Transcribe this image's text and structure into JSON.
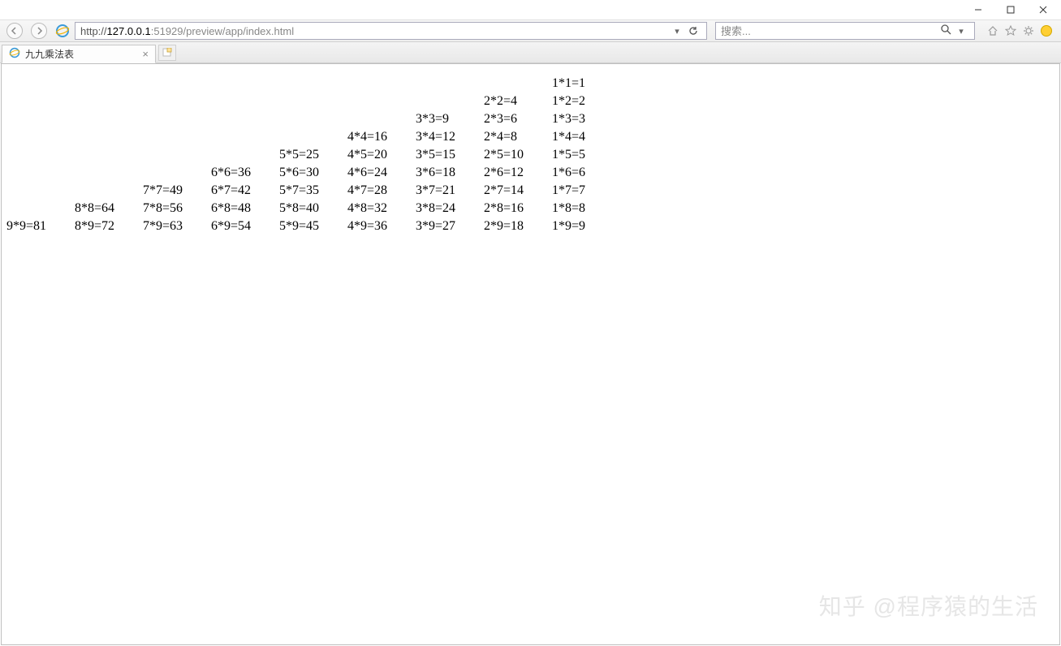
{
  "window": {
    "minimize": "—",
    "maximize": "☐",
    "close": "✕"
  },
  "toolbar": {
    "url_prefix": "http://",
    "url_host": "127.0.0.1",
    "url_rest": ":51929/preview/app/index.html",
    "search_placeholder": "搜索..."
  },
  "tab": {
    "title": "九九乘法表"
  },
  "watermark": "知乎 @程序猿的生活",
  "table": {
    "rows": [
      [
        "",
        "",
        "",
        "",
        "",
        "",
        "",
        "",
        "1*1=1"
      ],
      [
        "",
        "",
        "",
        "",
        "",
        "",
        "",
        "2*2=4",
        "1*2=2"
      ],
      [
        "",
        "",
        "",
        "",
        "",
        "",
        "3*3=9",
        "2*3=6",
        "1*3=3"
      ],
      [
        "",
        "",
        "",
        "",
        "",
        "4*4=16",
        "3*4=12",
        "2*4=8",
        "1*4=4"
      ],
      [
        "",
        "",
        "",
        "",
        "5*5=25",
        "4*5=20",
        "3*5=15",
        "2*5=10",
        "1*5=5"
      ],
      [
        "",
        "",
        "",
        "6*6=36",
        "5*6=30",
        "4*6=24",
        "3*6=18",
        "2*6=12",
        "1*6=6"
      ],
      [
        "",
        "",
        "7*7=49",
        "6*7=42",
        "5*7=35",
        "4*7=28",
        "3*7=21",
        "2*7=14",
        "1*7=7"
      ],
      [
        "",
        "8*8=64",
        "7*8=56",
        "6*8=48",
        "5*8=40",
        "4*8=32",
        "3*8=24",
        "2*8=16",
        "1*8=8"
      ],
      [
        "9*9=81",
        "8*9=72",
        "7*9=63",
        "6*9=54",
        "5*9=45",
        "4*9=36",
        "3*9=27",
        "2*9=18",
        "1*9=9"
      ]
    ]
  }
}
